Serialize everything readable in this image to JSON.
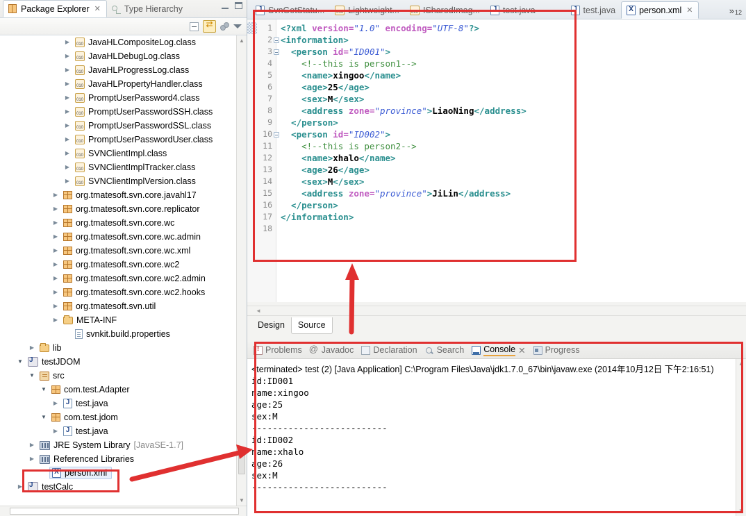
{
  "package_explorer": {
    "tabs": [
      {
        "label": "Package Explorer",
        "icon": "package-explorer-icon",
        "active": true,
        "close": "✕"
      },
      {
        "label": "Type Hierarchy",
        "icon": "type-hierarchy-icon",
        "active": false
      }
    ],
    "toolbar": {
      "collapse_all": "collapse-all-icon",
      "link_with_editor": "link-with-editor-icon",
      "view_menu_dots": "view-options-icon",
      "view_menu": "view-menu-icon",
      "minimize": "minimize-icon",
      "maximize": "maximize-icon"
    },
    "tree": [
      {
        "indent": 5,
        "arrow": "closed",
        "icon": "class",
        "label": "JavaHLCompositeLog.class"
      },
      {
        "indent": 5,
        "arrow": "closed",
        "icon": "class",
        "label": "JavaHLDebugLog.class"
      },
      {
        "indent": 5,
        "arrow": "closed",
        "icon": "class",
        "label": "JavaHLProgressLog.class"
      },
      {
        "indent": 5,
        "arrow": "closed",
        "icon": "class",
        "label": "JavaHLPropertyHandler.class"
      },
      {
        "indent": 5,
        "arrow": "closed",
        "icon": "class",
        "label": "PromptUserPassword4.class"
      },
      {
        "indent": 5,
        "arrow": "closed",
        "icon": "class",
        "label": "PromptUserPasswordSSH.class"
      },
      {
        "indent": 5,
        "arrow": "closed",
        "icon": "class",
        "label": "PromptUserPasswordSSL.class"
      },
      {
        "indent": 5,
        "arrow": "closed",
        "icon": "class",
        "label": "PromptUserPasswordUser.class"
      },
      {
        "indent": 5,
        "arrow": "closed",
        "icon": "class",
        "label": "SVNClientImpl.class"
      },
      {
        "indent": 5,
        "arrow": "closed",
        "icon": "class",
        "label": "SVNClientImplTracker.class"
      },
      {
        "indent": 5,
        "arrow": "closed",
        "icon": "class",
        "label": "SVNClientImplVersion.class"
      },
      {
        "indent": 4,
        "arrow": "closed",
        "icon": "pkg",
        "label": "org.tmatesoft.svn.core.javahl17"
      },
      {
        "indent": 4,
        "arrow": "closed",
        "icon": "pkg",
        "label": "org.tmatesoft.svn.core.replicator"
      },
      {
        "indent": 4,
        "arrow": "closed",
        "icon": "pkg",
        "label": "org.tmatesoft.svn.core.wc"
      },
      {
        "indent": 4,
        "arrow": "closed",
        "icon": "pkg",
        "label": "org.tmatesoft.svn.core.wc.admin"
      },
      {
        "indent": 4,
        "arrow": "closed",
        "icon": "pkg",
        "label": "org.tmatesoft.svn.core.wc.xml"
      },
      {
        "indent": 4,
        "arrow": "closed",
        "icon": "pkg",
        "label": "org.tmatesoft.svn.core.wc2"
      },
      {
        "indent": 4,
        "arrow": "closed",
        "icon": "pkg",
        "label": "org.tmatesoft.svn.core.wc2.admin"
      },
      {
        "indent": 4,
        "arrow": "closed",
        "icon": "pkg",
        "label": "org.tmatesoft.svn.core.wc2.hooks"
      },
      {
        "indent": 4,
        "arrow": "closed",
        "icon": "pkg",
        "label": "org.tmatesoft.svn.util"
      },
      {
        "indent": 4,
        "arrow": "closed",
        "icon": "folder",
        "label": "META-INF"
      },
      {
        "indent": 5,
        "arrow": "none",
        "icon": "props",
        "label": "svnkit.build.properties"
      },
      {
        "indent": 2,
        "arrow": "closed",
        "icon": "folder",
        "label": "lib"
      },
      {
        "indent": 1,
        "arrow": "open",
        "icon": "project",
        "label": "testJDOM"
      },
      {
        "indent": 2,
        "arrow": "open",
        "icon": "srcfolder",
        "label": "src"
      },
      {
        "indent": 3,
        "arrow": "open",
        "icon": "pkg",
        "label": "com.test.Adapter"
      },
      {
        "indent": 4,
        "arrow": "closed",
        "icon": "java",
        "label": "test.java"
      },
      {
        "indent": 3,
        "arrow": "open",
        "icon": "pkg",
        "label": "com.test.jdom"
      },
      {
        "indent": 4,
        "arrow": "closed",
        "icon": "java",
        "label": "test.java"
      },
      {
        "indent": 2,
        "arrow": "closed",
        "icon": "library",
        "label": "JRE System Library",
        "suffix": "[JavaSE-1.7]"
      },
      {
        "indent": 2,
        "arrow": "closed",
        "icon": "library",
        "label": "Referenced Libraries"
      },
      {
        "indent": 3,
        "arrow": "none",
        "icon": "xml",
        "label": "person.xml",
        "selected": true
      },
      {
        "indent": 1,
        "arrow": "closed",
        "icon": "project",
        "label": "testCalc"
      }
    ]
  },
  "editor": {
    "tabs": [
      {
        "label": "SvnGetStatu...",
        "icon": "java",
        "active": false
      },
      {
        "label": "Lightweight...",
        "icon": "class",
        "active": false
      },
      {
        "label": "ISharedImag...",
        "icon": "class",
        "active": false
      },
      {
        "label": "test.java",
        "icon": "java",
        "active": false
      },
      {
        "label": "test.java",
        "icon": "java-modified",
        "active": false
      },
      {
        "label": "person.xml",
        "icon": "xml",
        "active": true,
        "close": "✕"
      }
    ],
    "overflow": {
      "chevrons": "»",
      "count": "12"
    },
    "bottom_tabs": [
      {
        "label": "Design",
        "active": false
      },
      {
        "label": "Source",
        "active": true
      }
    ],
    "code_lines": [
      {
        "n": 1,
        "fold": false,
        "tokens": [
          {
            "t": "pn",
            "v": "<?xml "
          },
          {
            "t": "at",
            "v": "version="
          },
          {
            "t": "vl",
            "v": "\"1.0\""
          },
          {
            "t": "pn",
            "v": " "
          },
          {
            "t": "at",
            "v": "encoding="
          },
          {
            "t": "vl",
            "v": "\"UTF-8\""
          },
          {
            "t": "pn",
            "v": "?>"
          }
        ]
      },
      {
        "n": 2,
        "fold": true,
        "tokens": [
          {
            "t": "tg",
            "v": "<information>"
          }
        ]
      },
      {
        "n": 3,
        "fold": true,
        "tokens": [
          {
            "t": "tg",
            "v": "  <person "
          },
          {
            "t": "at",
            "v": "id="
          },
          {
            "t": "vl",
            "v": "\"ID001\""
          },
          {
            "t": "tg",
            "v": ">"
          }
        ]
      },
      {
        "n": 4,
        "fold": false,
        "tokens": [
          {
            "t": "cm",
            "v": "    <!--this is person1-->"
          }
        ]
      },
      {
        "n": 5,
        "fold": false,
        "tokens": [
          {
            "t": "tg",
            "v": "    <name>"
          },
          {
            "t": "tx",
            "v": "xingoo"
          },
          {
            "t": "tg",
            "v": "</name>"
          }
        ]
      },
      {
        "n": 6,
        "fold": false,
        "tokens": [
          {
            "t": "tg",
            "v": "    <age>"
          },
          {
            "t": "tx",
            "v": "25"
          },
          {
            "t": "tg",
            "v": "</age>"
          }
        ]
      },
      {
        "n": 7,
        "fold": false,
        "tokens": [
          {
            "t": "tg",
            "v": "    <sex>"
          },
          {
            "t": "tx",
            "v": "M"
          },
          {
            "t": "tg",
            "v": "</sex>"
          }
        ]
      },
      {
        "n": 8,
        "fold": false,
        "tokens": [
          {
            "t": "tg",
            "v": "    <address "
          },
          {
            "t": "at",
            "v": "zone="
          },
          {
            "t": "vl",
            "v": "\"province\""
          },
          {
            "t": "tg",
            "v": ">"
          },
          {
            "t": "tx",
            "v": "LiaoNing"
          },
          {
            "t": "tg",
            "v": "</address>"
          }
        ]
      },
      {
        "n": 9,
        "fold": false,
        "tokens": [
          {
            "t": "tg",
            "v": "  </person>"
          }
        ]
      },
      {
        "n": 10,
        "fold": true,
        "tokens": [
          {
            "t": "tg",
            "v": "  <person "
          },
          {
            "t": "at",
            "v": "id="
          },
          {
            "t": "vl",
            "v": "\"ID002\""
          },
          {
            "t": "tg",
            "v": ">"
          }
        ]
      },
      {
        "n": 11,
        "fold": false,
        "tokens": [
          {
            "t": "cm",
            "v": "    <!--this is person2-->"
          }
        ]
      },
      {
        "n": 12,
        "fold": false,
        "tokens": [
          {
            "t": "tg",
            "v": "    <name>"
          },
          {
            "t": "tx",
            "v": "xhalo"
          },
          {
            "t": "tg",
            "v": "</name>"
          }
        ]
      },
      {
        "n": 13,
        "fold": false,
        "tokens": [
          {
            "t": "tg",
            "v": "    <age>"
          },
          {
            "t": "tx",
            "v": "26"
          },
          {
            "t": "tg",
            "v": "</age>"
          }
        ]
      },
      {
        "n": 14,
        "fold": false,
        "tokens": [
          {
            "t": "tg",
            "v": "    <sex>"
          },
          {
            "t": "tx",
            "v": "M"
          },
          {
            "t": "tg",
            "v": "</sex>"
          }
        ]
      },
      {
        "n": 15,
        "fold": false,
        "tokens": [
          {
            "t": "tg",
            "v": "    <address "
          },
          {
            "t": "at",
            "v": "zone="
          },
          {
            "t": "vl",
            "v": "\"province\""
          },
          {
            "t": "tg",
            "v": ">"
          },
          {
            "t": "tx",
            "v": "JiLin"
          },
          {
            "t": "tg",
            "v": "</address>"
          }
        ]
      },
      {
        "n": 16,
        "fold": false,
        "tokens": [
          {
            "t": "tg",
            "v": "  </person>"
          }
        ]
      },
      {
        "n": 17,
        "fold": false,
        "tokens": [
          {
            "t": "tg",
            "v": "</information>"
          }
        ]
      },
      {
        "n": 18,
        "fold": false,
        "tokens": [
          {
            "t": "tx",
            "v": ""
          }
        ]
      }
    ]
  },
  "console": {
    "tabs": [
      {
        "label": "Problems",
        "icon": "problems-icon",
        "active": false
      },
      {
        "label": "Javadoc",
        "icon": "javadoc-icon",
        "active": false
      },
      {
        "label": "Declaration",
        "icon": "declaration-icon",
        "active": false
      },
      {
        "label": "Search",
        "icon": "search-icon",
        "active": false
      },
      {
        "label": "Console",
        "icon": "console-icon",
        "active": true,
        "close": "✕"
      },
      {
        "label": "Progress",
        "icon": "progress-icon",
        "active": false
      }
    ],
    "terminated_line": "<terminated> test (2) [Java Application] C:\\Program Files\\Java\\jdk1.7.0_67\\bin\\javaw.exe (2014年10月12日 下午2:16:51)",
    "output": [
      "id:ID001",
      "name:xingoo",
      "age:25",
      "sex:M",
      "--------------------------",
      "id:ID002",
      "name:xhalo",
      "age:26",
      "sex:M",
      "--------------------------"
    ]
  },
  "annotations": {
    "highlight_color": "#e03030",
    "boxes": [
      "editor-xml-source",
      "console-output",
      "person-xml-tree-item"
    ],
    "arrows": [
      "arrow-up-to-editor",
      "arrow-from-person-xml-to-console"
    ]
  }
}
